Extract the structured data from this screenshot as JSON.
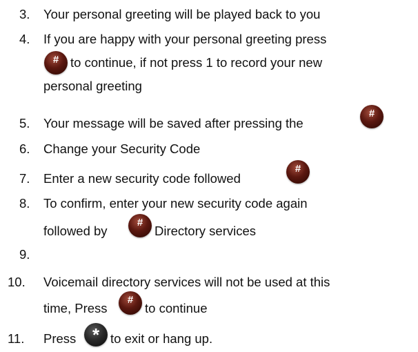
{
  "items": [
    {
      "number": "3.",
      "text": "Your personal greeting will be played back to you"
    },
    {
      "number": "4.",
      "text_a": "If you are happy with your personal greeting press",
      "text_b": "to continue, if not press 1 to record your new",
      "text_c": "personal greeting"
    },
    {
      "number": "5.",
      "text": "Your message will be saved after pressing the"
    },
    {
      "number": "6.",
      "text": "Change your Security Code"
    },
    {
      "number": "7.",
      "text": "Enter a new security code followed"
    },
    {
      "number": "8.",
      "text_a": "To confirm, enter your new security code again",
      "text_b": "followed by",
      "text_c": "Directory services"
    },
    {
      "number": "9.",
      "text": ""
    },
    {
      "number": "10.",
      "text_a": "Voicemail directory services will not be used at this",
      "text_b": "time, Press",
      "text_c": "to continue"
    },
    {
      "number": "11.",
      "text_a": "Press",
      "text_b": "to exit or hang up."
    }
  ],
  "keys": {
    "hash_label": "#",
    "star_label": "*",
    "hash_color": "#5b1810",
    "star_color": "#1e1e1e"
  }
}
